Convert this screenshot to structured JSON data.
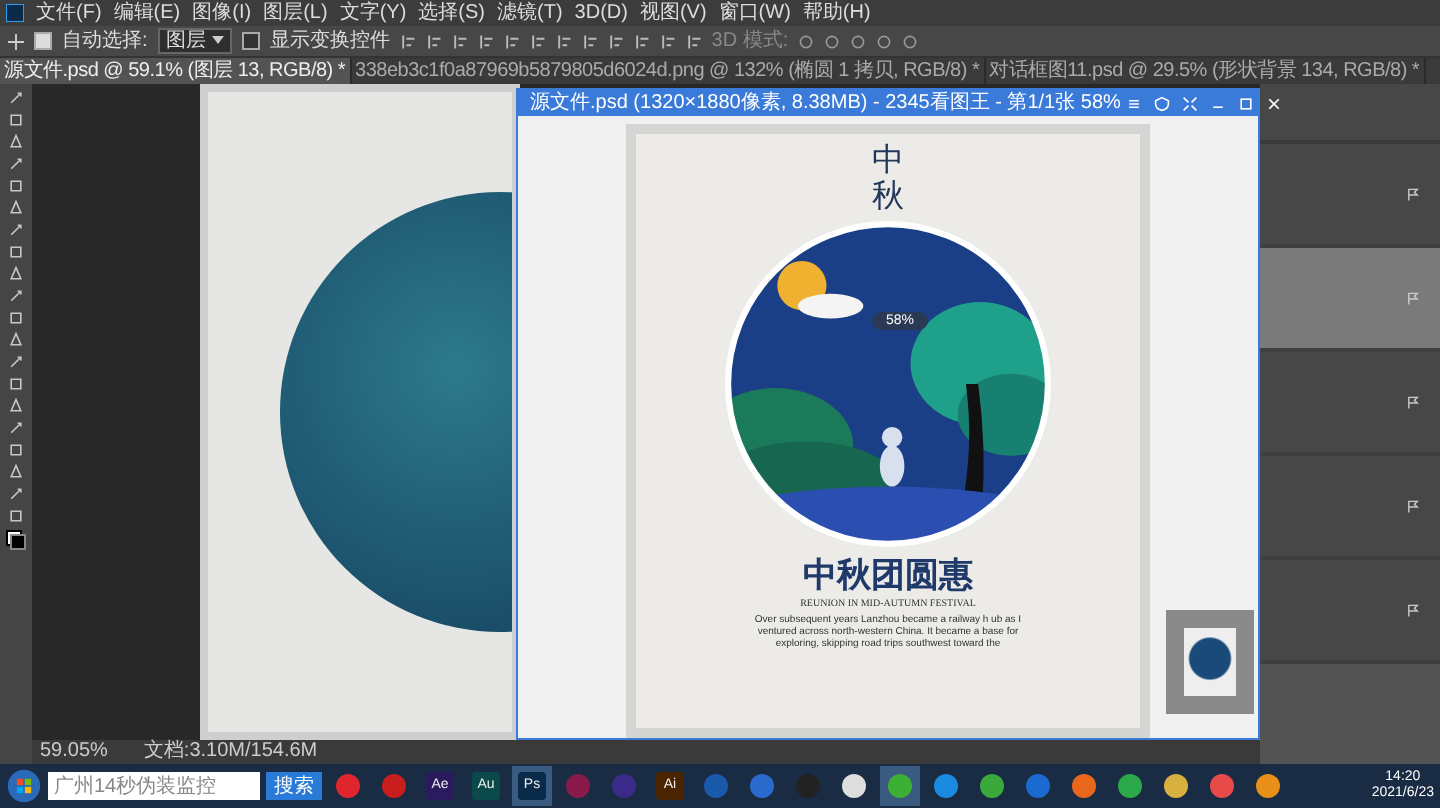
{
  "menu": [
    "文件(F)",
    "编辑(E)",
    "图像(I)",
    "图层(L)",
    "文字(Y)",
    "选择(S)",
    "滤镜(T)",
    "3D(D)",
    "视图(V)",
    "窗口(W)",
    "帮助(H)"
  ],
  "options": {
    "auto_select": {
      "label": "自动选择:",
      "checked": true
    },
    "target": "图层",
    "transform": {
      "label": "显示变换控件",
      "checked": false
    },
    "mode_label": "3D 模式:"
  },
  "tabs": [
    {
      "label": "源文件.psd @ 59.1% (图层 13, RGB/8) *",
      "selected": true
    },
    {
      "label": "338eb3c1f0a87969b5879805d6024d.png @ 132% (椭圆 1 拷贝, RGB/8) *",
      "selected": false
    },
    {
      "label": "对话框图11.psd @ 29.5% (形状背景 134, RGB/8) *",
      "selected": false
    }
  ],
  "viewer": {
    "title": "源文件.psd (1320×1880像素, 8.38MB) - 2345看图王 - 第1/1张 58%",
    "zoom": "58%",
    "poster": {
      "calligraphy": "中秋",
      "title": "中秋团圆惠",
      "subtitle": "REUNION IN MID-AUTUMN FESTIVAL",
      "body": "Over subsequent years Lanzhou became a railway h ub as I ventured across north-western China. It became a base for exploring, skipping road trips southwest toward the"
    }
  },
  "layers": [
    {
      "selected": false
    },
    {
      "selected": true
    },
    {
      "selected": false
    },
    {
      "selected": false
    },
    {
      "selected": false
    }
  ],
  "status_bar": {
    "zoom": "59.05%",
    "doc": "文档:3.10M/154.6M"
  },
  "taskbar": {
    "search_placeholder": "广州14秒伪装监控",
    "search_button": "搜索",
    "apps": [
      {
        "kind": "dot",
        "color": "#e0262c",
        "active": false
      },
      {
        "kind": "dot",
        "color": "#c81e1e",
        "active": false
      },
      {
        "kind": "letter",
        "label": "Ae",
        "color": "#2a1a5e",
        "active": false
      },
      {
        "kind": "letter",
        "label": "Au",
        "color": "#0b4a4a",
        "active": false
      },
      {
        "kind": "letter",
        "label": "Ps",
        "color": "#0a2a4a",
        "active": true
      },
      {
        "kind": "dot",
        "color": "#8a1a4a",
        "active": false
      },
      {
        "kind": "dot",
        "color": "#3a2a8a",
        "active": false
      },
      {
        "kind": "letter",
        "label": "Ai",
        "color": "#4a2300",
        "active": false
      },
      {
        "kind": "dot",
        "color": "#1a5aaa",
        "active": false
      },
      {
        "kind": "dot",
        "color": "#2a6acc",
        "active": false
      },
      {
        "kind": "dot",
        "color": "#222222",
        "active": false
      },
      {
        "kind": "dot",
        "color": "#dddddd",
        "active": false
      },
      {
        "kind": "dot",
        "color": "#3cb034",
        "active": true
      },
      {
        "kind": "dot",
        "color": "#1a8ae0",
        "active": false
      },
      {
        "kind": "dot",
        "color": "#3aa83a",
        "active": false
      },
      {
        "kind": "dot",
        "color": "#1a6ad0",
        "active": false
      },
      {
        "kind": "dot",
        "color": "#e8671a",
        "active": false
      },
      {
        "kind": "dot",
        "color": "#2aa84a",
        "active": false
      },
      {
        "kind": "dot",
        "color": "#d8b040",
        "active": false
      },
      {
        "kind": "dot",
        "color": "#e84a4a",
        "active": false
      },
      {
        "kind": "dot",
        "color": "#e8901a",
        "active": false
      }
    ],
    "time": "14:20",
    "date": "2021/6/23"
  }
}
